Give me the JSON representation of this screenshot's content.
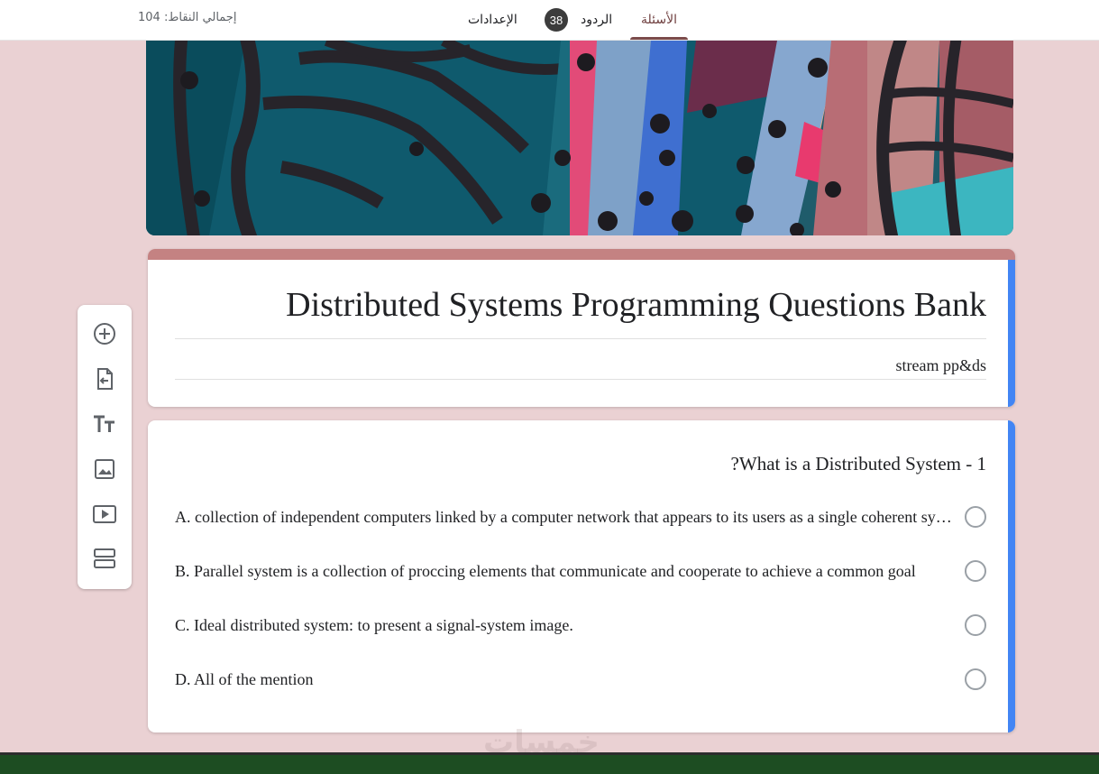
{
  "header": {
    "total_points": "إجمالي النقاط: 104",
    "tabs": {
      "settings": "الإعدادات",
      "responses": "الردود",
      "responses_count": "38",
      "questions": "الأسئلة"
    }
  },
  "form": {
    "title": "Distributed Systems Programming Questions Bank",
    "description": "stream pp&ds"
  },
  "question": {
    "text": "?What is a Distributed System - 1",
    "options": [
      "A. collection of independent computers linked by a computer network that appears to its users as a single coherent system",
      "B. Parallel system is a collection of proccing elements that communicate and cooperate to achieve a common goal",
      "C. Ideal distributed system: to present a signal-system image.",
      "D. All of the mention"
    ]
  },
  "toolbar": {
    "icons": [
      "add-question-icon",
      "import-questions-icon",
      "add-title-icon",
      "add-image-icon",
      "add-video-icon",
      "add-section-icon"
    ]
  },
  "watermark": "خمسات",
  "colors": {
    "background": "#ead1d3",
    "accent": "#4285f4",
    "theme_strip": "#c48282",
    "active_tab": "#7b4b4b"
  }
}
